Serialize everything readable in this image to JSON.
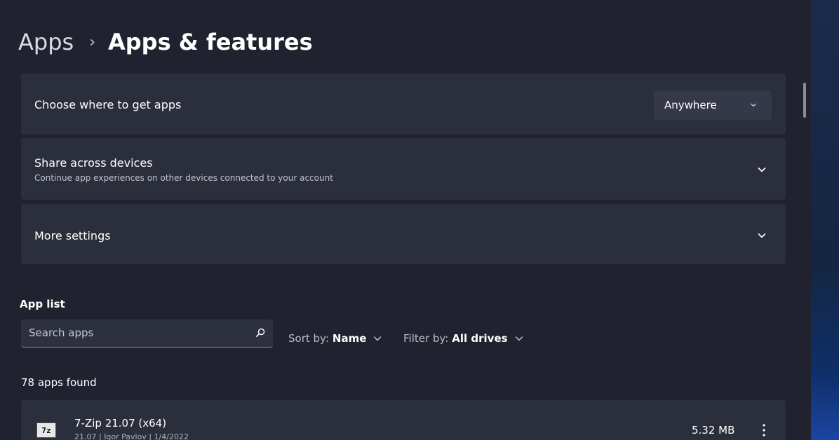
{
  "breadcrumb": {
    "parent": "Apps",
    "separator": "›",
    "current": "Apps & features"
  },
  "settings": {
    "where_to_get": {
      "label": "Choose where to get apps",
      "selected": "Anywhere"
    },
    "share_across_devices": {
      "label": "Share across devices",
      "description": "Continue app experiences on other devices connected to your account"
    },
    "more_settings": {
      "label": "More settings"
    }
  },
  "app_list": {
    "title": "App list",
    "search_placeholder": "Search apps",
    "sort_label": "Sort by:",
    "sort_value": "Name",
    "filter_label": "Filter by:",
    "filter_value": "All drives",
    "count_text": "78 apps found",
    "items": [
      {
        "icon_text": "7z",
        "name": "7-Zip 21.07 (x64)",
        "meta": "21.07 | Igor Pavlov | 1/4/2022",
        "size": "5.32 MB"
      }
    ]
  },
  "colors": {
    "background": "#20232f",
    "card": "#2b2e3b",
    "dropdown": "#353848"
  },
  "icons": {
    "chevron": "chevron-down-icon",
    "search": "search-icon",
    "more": "more-vertical-icon"
  }
}
